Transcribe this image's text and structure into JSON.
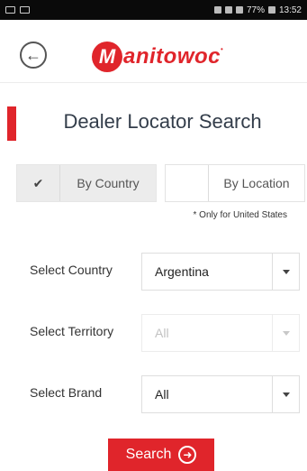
{
  "status_bar": {
    "battery": "77%",
    "time": "13:52"
  },
  "header": {
    "logo_text": "anitowoc",
    "logo_letter": "M"
  },
  "page": {
    "title": "Dealer Locator Search"
  },
  "search_mode": {
    "by_country": {
      "label": "By Country",
      "selected": true,
      "check": "✔"
    },
    "by_location": {
      "label": "By Location",
      "selected": false
    },
    "note": "* Only for United States"
  },
  "form": {
    "country": {
      "label": "Select Country",
      "value": "Argentina"
    },
    "territory": {
      "label": "Select Territory",
      "value": "All",
      "disabled": true
    },
    "brand": {
      "label": "Select Brand",
      "value": "All"
    }
  },
  "actions": {
    "search_label": "Search"
  },
  "colors": {
    "brand_red": "#e0252b",
    "title_text": "#333d4a"
  }
}
